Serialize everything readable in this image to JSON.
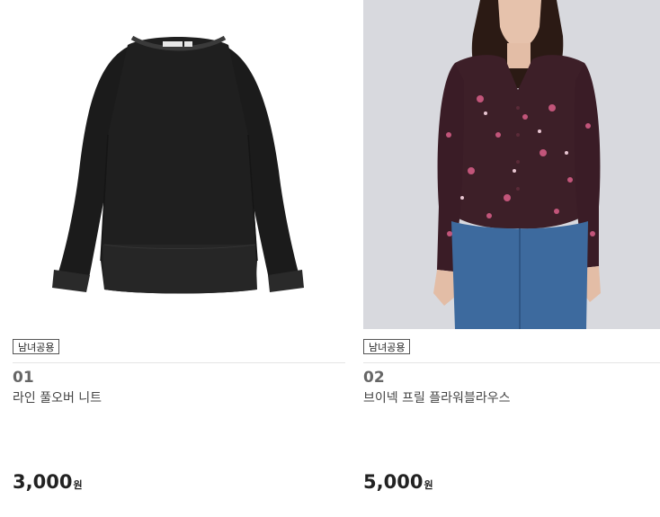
{
  "products": [
    {
      "badge": "남녀공용",
      "number": "01",
      "name": "라인 풀오버 니트",
      "price": "3,000",
      "currency": "원",
      "image_icon": "black-sweater-image"
    },
    {
      "badge": "남녀공용",
      "number": "02",
      "name": "브이넥 프릴 플라워블라우스",
      "price": "5,000",
      "currency": "원",
      "image_icon": "floral-blouse-model-image"
    }
  ]
}
